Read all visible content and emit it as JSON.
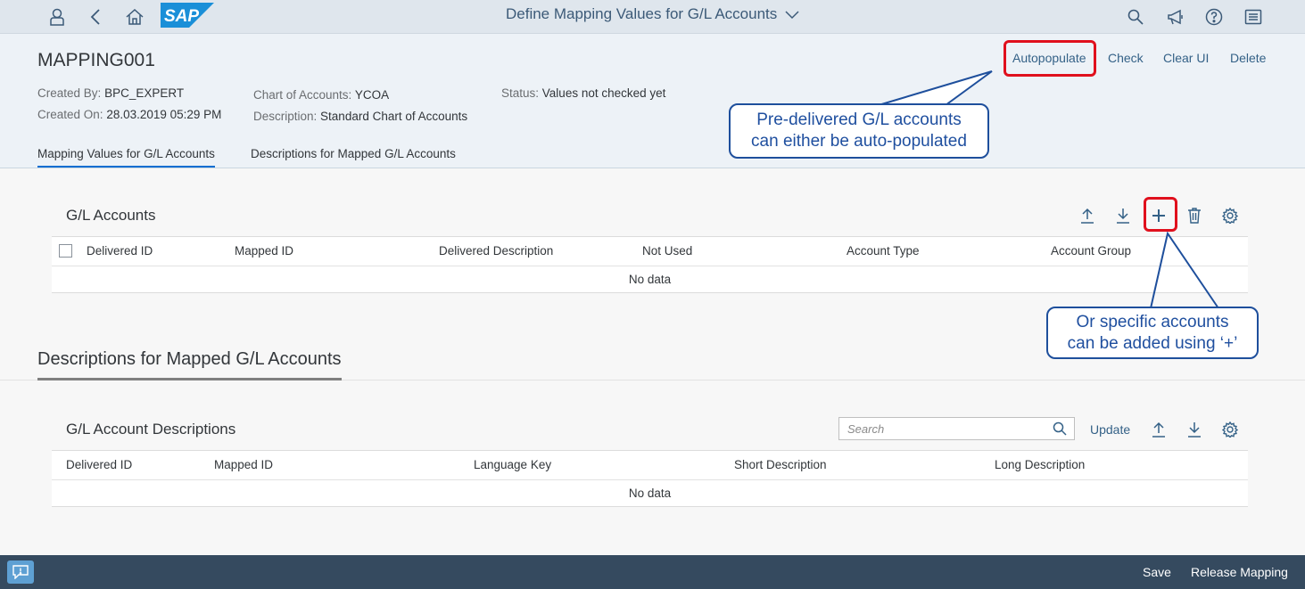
{
  "shell": {
    "title": "Define Mapping Values for G/L Accounts",
    "logo": "SAP",
    "icons": [
      "user-icon",
      "back-icon",
      "home-icon",
      "search-icon",
      "notification-icon",
      "help-icon",
      "menu-icon"
    ]
  },
  "header": {
    "object_id": "MAPPING001",
    "actions": {
      "autopopulate": "Autopopulate",
      "check": "Check",
      "clear_ui": "Clear UI",
      "delete": "Delete"
    },
    "created_by_label": "Created By:",
    "created_by": "BPC_EXPERT",
    "created_on_label": "Created On:",
    "created_on": "28.03.2019 05:29 PM",
    "chart_of_accounts_label": "Chart of Accounts:",
    "chart_of_accounts": "YCOA",
    "description_label": "Description:",
    "description": "Standard Chart of Accounts",
    "status_label": "Status:",
    "status": "Values not checked yet",
    "tabs": [
      "Mapping Values for G/L Accounts",
      "Descriptions for Mapped G/L Accounts"
    ]
  },
  "gl_accounts": {
    "title": "G/L Accounts",
    "columns": [
      "Delivered ID",
      "Mapped ID",
      "Delivered Description",
      "Not Used",
      "Account Type",
      "Account Group"
    ],
    "empty_text": "No data"
  },
  "descriptions_section": {
    "title": "Descriptions for Mapped G/L Accounts"
  },
  "gl_descriptions": {
    "title": "G/L Account Descriptions",
    "search_placeholder": "Search",
    "update_label": "Update",
    "columns": [
      "Delivered ID",
      "Mapped ID",
      "Language Key",
      "Short Description",
      "Long Description"
    ],
    "empty_text": "No data"
  },
  "footer": {
    "save": "Save",
    "release": "Release Mapping"
  },
  "callouts": {
    "autopopulate_line1": "Pre-delivered G/L accounts",
    "autopopulate_line2": "can either be auto-populated",
    "add_line1": "Or specific accounts",
    "add_line2": "can be added using ‘+’"
  },
  "colors": {
    "accent": "#346187",
    "highlight": "#e0101d",
    "callout": "#1e4f9c",
    "footer": "#354a5f"
  }
}
